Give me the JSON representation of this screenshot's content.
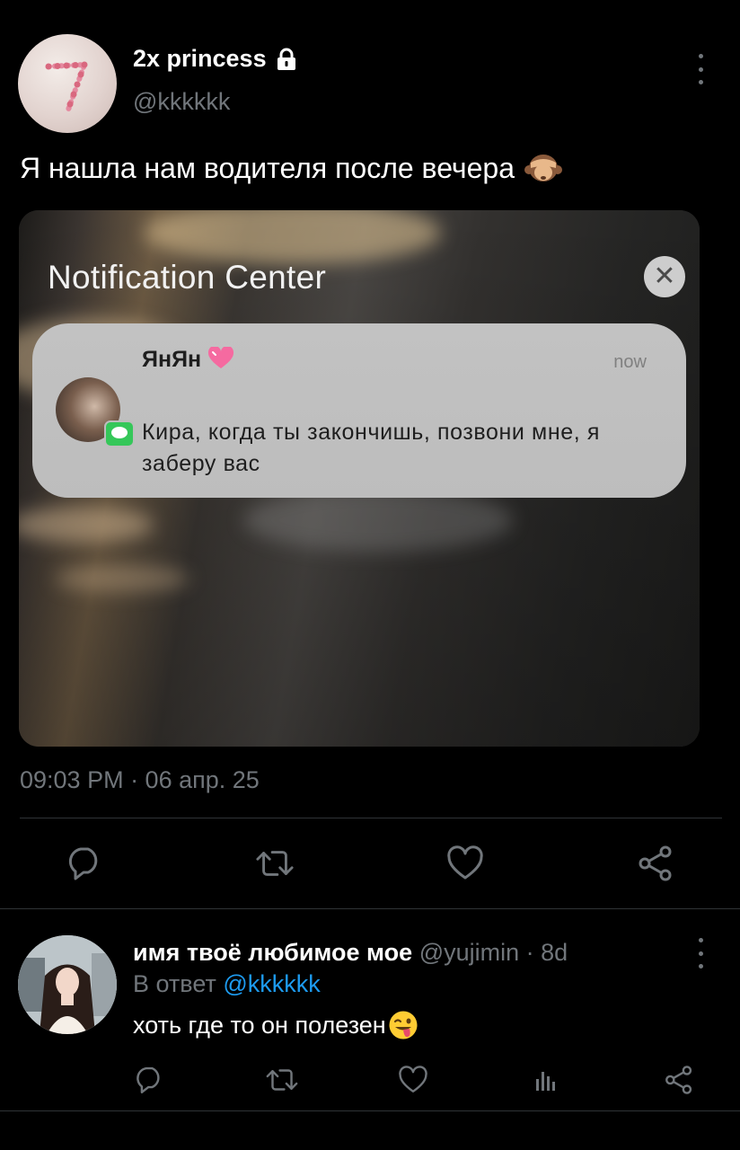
{
  "tweet": {
    "display_name": "2x princess",
    "handle": "@kkkkkk",
    "text": "Я нашла нам водителя после вечера",
    "text_emoji": "see-no-evil-monkey-emoji",
    "timestamp": "09:03 PM · 06 апр. 25"
  },
  "media": {
    "title": "Notification Center",
    "close_symbol": "✕",
    "notification": {
      "sender": "ЯнЯн",
      "sender_emoji": "pink-heart-emoji",
      "time": "now",
      "message": "Кира, когда ты закончишь, позвони мне, я заберу вас"
    }
  },
  "tweet_actions": [
    "reply",
    "retweet",
    "like",
    "share"
  ],
  "reply": {
    "display_name": "имя твоё любимое мое",
    "handle": "@yujimin",
    "age": "· 8d",
    "replying_to_prefix": "В ответ",
    "replying_to_handle": "@kkkkkk",
    "text": "хоть где то он полезен",
    "text_emoji": "winking-face-with-tongue-emoji",
    "actions": [
      "reply",
      "retweet",
      "like",
      "views",
      "share"
    ]
  },
  "colors": {
    "background": "#000000",
    "primary_text": "#e7e9ea",
    "secondary_text": "#71767b",
    "link": "#1d9bf0",
    "divider": "#2f3336"
  }
}
